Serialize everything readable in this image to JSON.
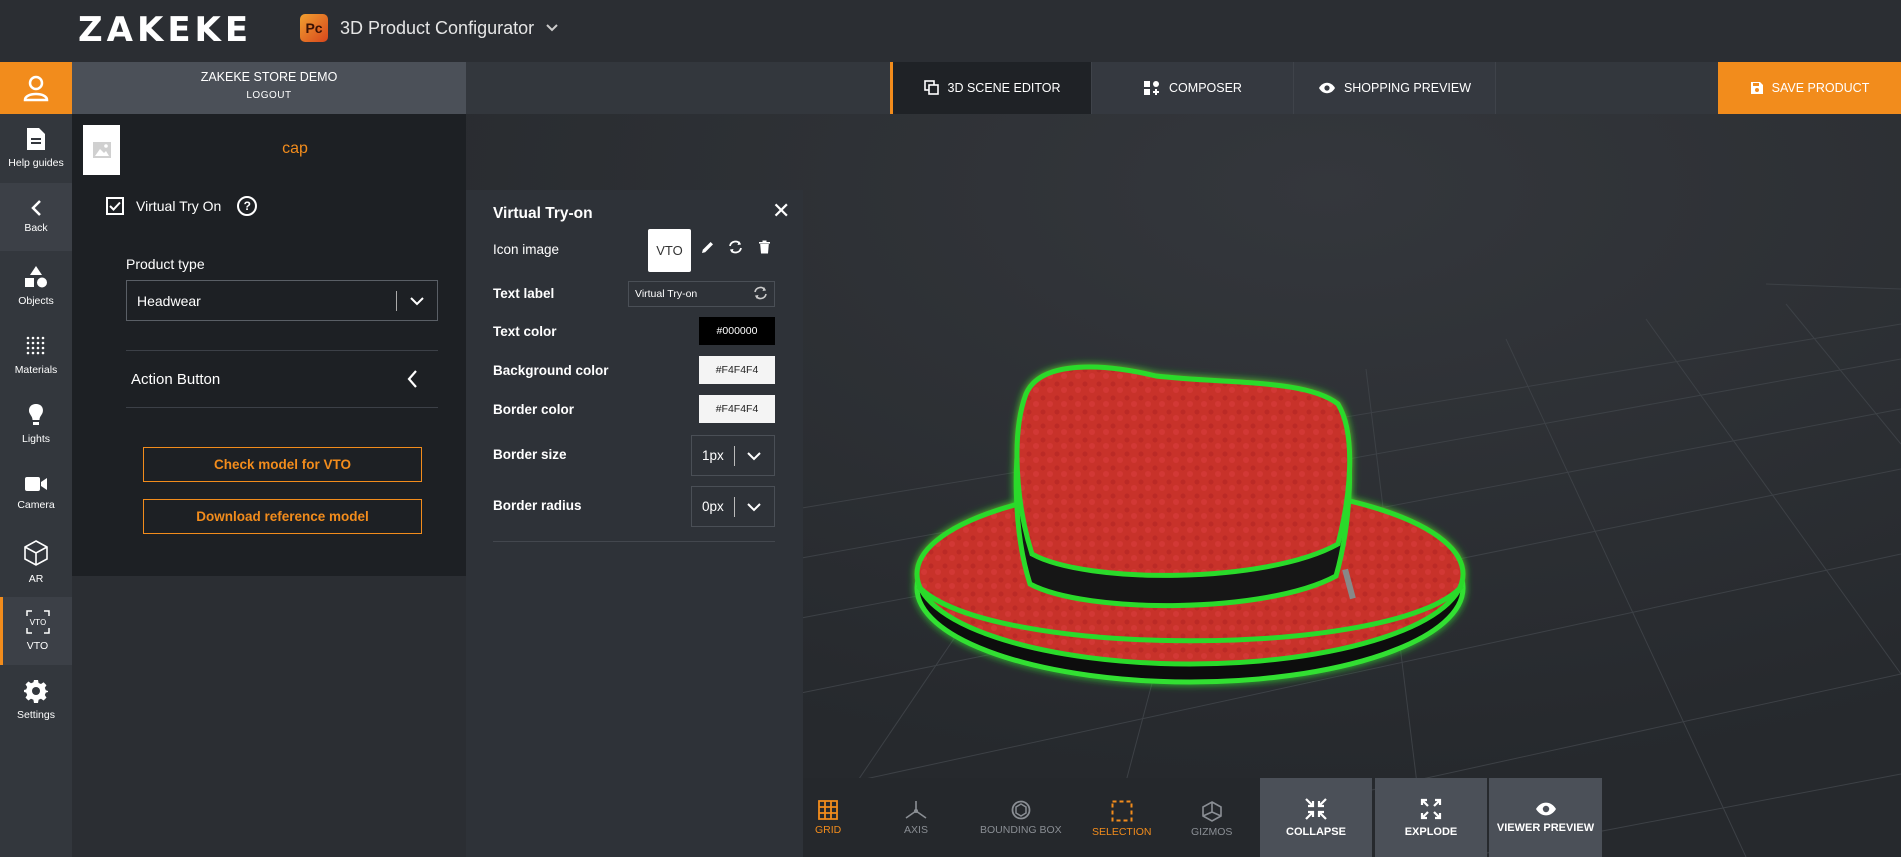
{
  "header": {
    "logo": "ZAKEKE",
    "app_badge": "Pc",
    "app_title": "3D Product Configurator"
  },
  "account": {
    "store_name": "ZAKEKE STORE DEMO",
    "logout": "LOGOUT"
  },
  "tabs": [
    {
      "label": "3D SCENE EDITOR",
      "icon": "layers-icon",
      "active": true
    },
    {
      "label": "COMPOSER",
      "icon": "composer-icon",
      "active": false
    },
    {
      "label": "SHOPPING PREVIEW",
      "icon": "eye-icon",
      "active": false
    }
  ],
  "save_button": "SAVE PRODUCT",
  "sidebar": {
    "items": [
      {
        "label": "Help guides",
        "icon": "document-icon"
      },
      {
        "label": "Back",
        "icon": "chevron-left-icon"
      },
      {
        "label": "Objects",
        "icon": "shapes-icon"
      },
      {
        "label": "Materials",
        "icon": "materials-icon"
      },
      {
        "label": "Lights",
        "icon": "lightbulb-icon"
      },
      {
        "label": "Camera",
        "icon": "camera-icon"
      },
      {
        "label": "AR",
        "icon": "ar-cube-icon"
      },
      {
        "label": "VTO",
        "icon": "vto-icon"
      },
      {
        "label": "Settings",
        "icon": "gear-icon"
      }
    ]
  },
  "panel": {
    "model_name": "cap",
    "vto_checkbox_label": "Virtual Try On",
    "vto_checked": true,
    "product_type_label": "Product type",
    "product_type_value": "Headwear",
    "action_button_label": "Action Button",
    "check_button": "Check model for VTO",
    "download_button": "Download reference model"
  },
  "vto_panel": {
    "title": "Virtual Try-on",
    "icon_image_label": "Icon image",
    "icon_image_text": "VTO",
    "text_label_label": "Text label",
    "text_label_value": "Virtual Try-on",
    "text_color_label": "Text color",
    "text_color_value": "#000000",
    "background_color_label": "Background color",
    "background_color_value": "#F4F4F4",
    "border_color_label": "Border color",
    "border_color_value": "#F4F4F4",
    "border_size_label": "Border size",
    "border_size_value": "1px",
    "border_radius_label": "Border radius",
    "border_radius_value": "0px"
  },
  "bottom_toolbar": {
    "toggles": [
      {
        "label": "GRID",
        "icon": "grid-icon",
        "active": true
      },
      {
        "label": "AXIS",
        "icon": "axis-icon",
        "active": false
      },
      {
        "label": "BOUNDING BOX",
        "icon": "bounding-box-icon",
        "active": false
      },
      {
        "label": "SELECTION",
        "icon": "selection-icon",
        "active": true
      },
      {
        "label": "GIZMOS",
        "icon": "gizmo-icon",
        "active": false
      }
    ],
    "collapse": "COLLAPSE",
    "explode": "EXPLODE",
    "viewer_preview": "VIEWER PREVIEW"
  },
  "colors": {
    "accent": "#F28C1C",
    "selection_glow": "#2BDA2B",
    "hat_red": "#C8302C"
  }
}
